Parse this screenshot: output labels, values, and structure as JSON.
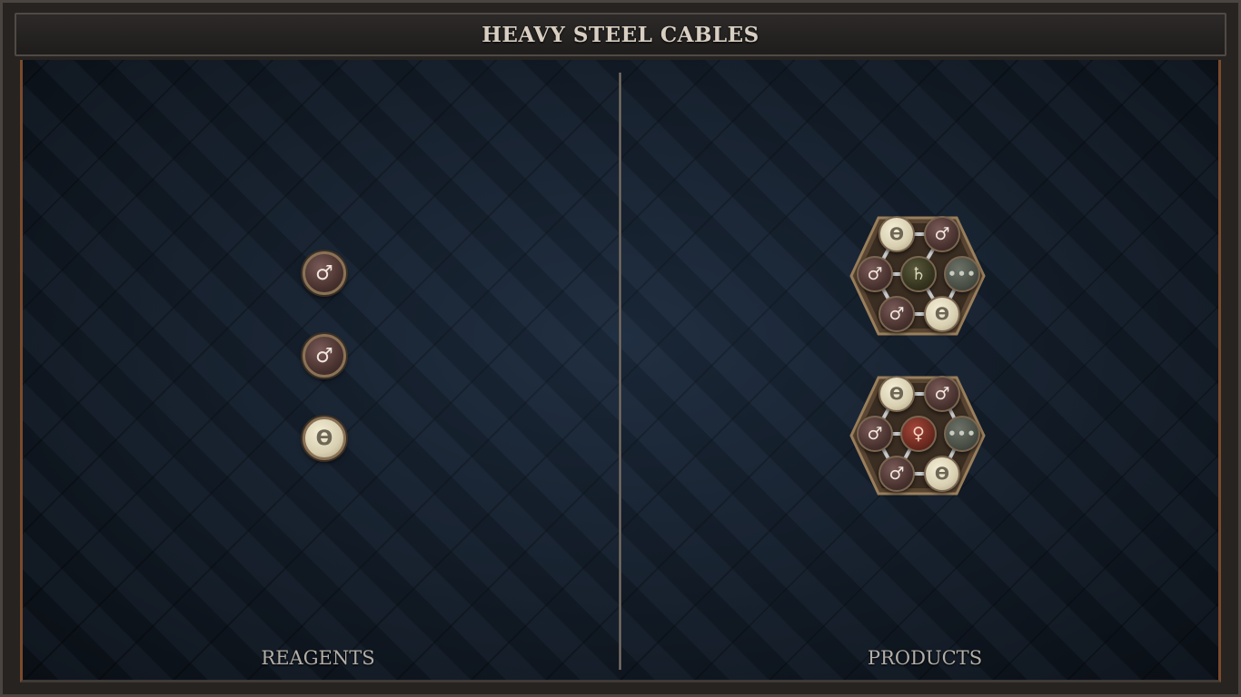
{
  "title": "HEAVY STEEL CABLES",
  "labels": {
    "reagents": "REAGENTS",
    "products": "PRODUCTS"
  },
  "reagents": [
    {
      "element": "copper",
      "symbol": "♂"
    },
    {
      "element": "copper",
      "symbol": "♂"
    },
    {
      "element": "salt",
      "symbol": "ϴ"
    }
  ],
  "products": [
    {
      "atoms": {
        "top_left": {
          "element": "salt",
          "symbol": "ϴ"
        },
        "top_right": {
          "element": "copper",
          "symbol": "♂"
        },
        "left": {
          "element": "copper",
          "symbol": "♂"
        },
        "center": {
          "element": "lead",
          "symbol": "♄"
        },
        "right": {
          "element": "quintessence",
          "symbol": "•••"
        },
        "bottom_left": {
          "element": "copper",
          "symbol": "♂"
        },
        "bottom_right": {
          "element": "salt",
          "symbol": "ϴ"
        }
      }
    },
    {
      "atoms": {
        "top_left": {
          "element": "salt",
          "symbol": "ϴ"
        },
        "top_right": {
          "element": "copper",
          "symbol": "♂"
        },
        "left": {
          "element": "copper",
          "symbol": "♂"
        },
        "center": {
          "element": "iron",
          "symbol": "♀"
        },
        "right": {
          "element": "quintessence",
          "symbol": "•••"
        },
        "bottom_left": {
          "element": "copper",
          "symbol": "♂"
        },
        "bottom_right": {
          "element": "salt",
          "symbol": "ϴ"
        }
      }
    }
  ],
  "colors": {
    "board": "#182433",
    "frame_accent": "#7a4a2c",
    "title_text": "#d8cfc2",
    "label_text": "#b3aea7"
  }
}
